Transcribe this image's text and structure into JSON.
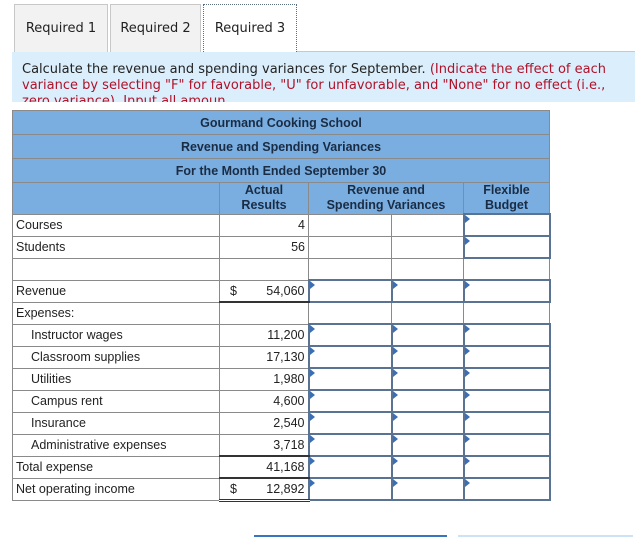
{
  "tabs": [
    {
      "label": "Required 1",
      "active": false
    },
    {
      "label": "Required 2",
      "active": false
    },
    {
      "label": "Required 3",
      "active": true
    }
  ],
  "instructions": {
    "text": "Calculate the revenue and spending variances for September.",
    "note": "(Indicate the effect of each variance by selecting \"F\" for favorable, \"U\" for unfavorable, and \"None\" for no effect (i.e., zero variance). Input all amoun"
  },
  "worksheet": {
    "company": "Gourmand Cooking School",
    "report_title": "Revenue and Spending Variances",
    "period": "For the Month Ended September 30",
    "columns": {
      "actual_line1": "Actual",
      "actual_line2": "Results",
      "variance_line1": "Revenue and",
      "variance_line2": "Spending Variances",
      "budget_line1": "Flexible",
      "budget_line2": "Budget"
    },
    "currency_symbol": "$",
    "rows": {
      "courses": {
        "label": "Courses",
        "actual": "4"
      },
      "students": {
        "label": "Students",
        "actual": "56"
      },
      "revenue": {
        "label": "Revenue",
        "actual": "54,060"
      },
      "expenses": {
        "label": "Expenses:"
      },
      "instructor_wages": {
        "label": "Instructor wages",
        "actual": "11,200"
      },
      "classroom_supplies": {
        "label": "Classroom supplies",
        "actual": "17,130"
      },
      "utilities": {
        "label": "Utilities",
        "actual": "1,980"
      },
      "campus_rent": {
        "label": "Campus rent",
        "actual": "4,600"
      },
      "insurance": {
        "label": "Insurance",
        "actual": "2,540"
      },
      "administrative_expenses": {
        "label": "Administrative expenses",
        "actual": "3,718"
      },
      "total_expense": {
        "label": "Total expense",
        "actual": "41,168"
      },
      "net_operating_income": {
        "label": "Net operating income",
        "actual": "12,892"
      }
    }
  },
  "colors": {
    "header_blue": "#7aaee0",
    "instruction_bg": "#dbeefb",
    "note_red": "#b0122a",
    "input_border": "#5b7393"
  }
}
